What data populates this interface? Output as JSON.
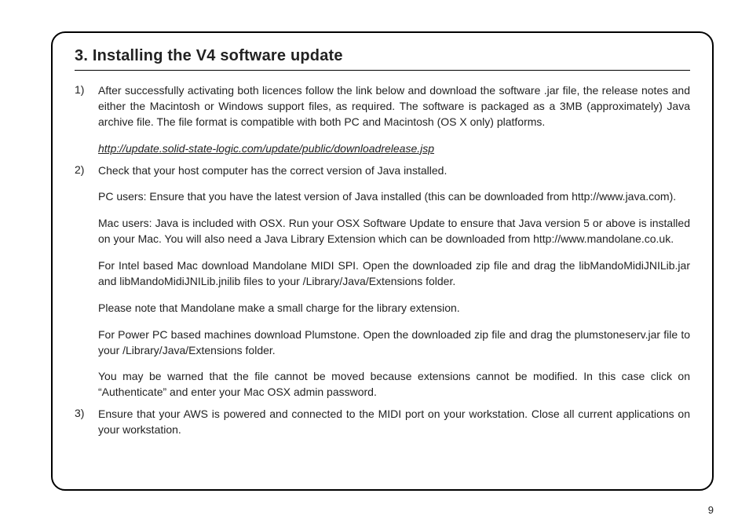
{
  "page_number": "9",
  "section_title": "3. Installing the V4 software update",
  "steps": [
    {
      "paragraphs": [
        "After successfully activating both licences follow the link below and download the software .jar file, the release notes and either the Macintosh or Windows support files, as required. The software is packaged as a 3MB (approximately) Java archive file. The file format is compatible with both PC and Macintosh (OS X only) platforms."
      ],
      "link": "http://update.solid-state-logic.com/update/public/downloadrelease.jsp"
    },
    {
      "paragraphs": [
        "Check that your host computer has the correct version of Java installed.",
        "PC users: Ensure that you have the latest version of Java installed (this can be downloaded from http://www.java.com).",
        "Mac users: Java is included with OSX. Run your OSX Software Update to ensure that Java version 5 or above is installed on your Mac. You will also need a Java Library Extension which can be downloaded from http://www.mandolane.co.uk.",
        "For Intel based Mac download Mandolane MIDI SPI. Open the downloaded zip file and drag the libMandoMidiJNILib.jar and libMandoMidiJNILib.jnilib files to your /Library/Java/Extensions folder.",
        "Please note that Mandolane make a small charge for the library extension.",
        "For Power PC based machines download Plumstone. Open the downloaded zip file and drag the plumstoneserv.jar file to your /Library/Java/Extensions folder.",
        "You may be warned that the file cannot be moved because extensions cannot be modified. In this case click on “Authenticate” and enter your Mac OSX admin password."
      ]
    },
    {
      "paragraphs": [
        "Ensure that your AWS is powered and connected to the MIDI port on your workstation. Close all current applications on your workstation."
      ]
    }
  ]
}
